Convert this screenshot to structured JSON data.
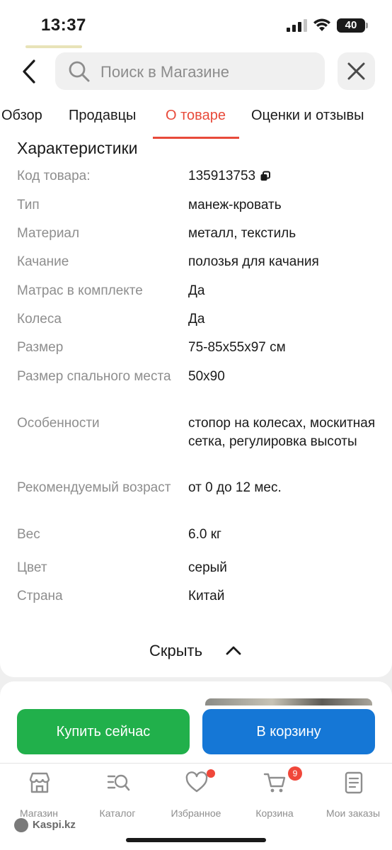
{
  "status_bar": {
    "time": "13:37",
    "battery": "40"
  },
  "search": {
    "placeholder": "Поиск в Магазине"
  },
  "tabs": [
    {
      "label": "Обзор",
      "active": false
    },
    {
      "label": "Продавцы",
      "active": false
    },
    {
      "label": "О товаре",
      "active": true
    },
    {
      "label": "Оценки и отзывы",
      "active": false
    }
  ],
  "specs": {
    "title": "Характеристики",
    "rows": [
      {
        "label": "Код товара:",
        "value": "135913753"
      },
      {
        "label": "Тип",
        "value": "манеж-кровать"
      },
      {
        "label": "Материал",
        "value": "металл, текстиль"
      },
      {
        "label": "Качание",
        "value": "полозья для качания"
      },
      {
        "label": "Матрас в комплекте",
        "value": "Да"
      },
      {
        "label": "Колеса",
        "value": "Да"
      },
      {
        "label": "Размер",
        "value": "75-85x55x97 см"
      },
      {
        "label": "Размер спального места",
        "value": "50x90"
      },
      {
        "label": "Особенности",
        "value": "стопор на колесах, москитная сетка, регулировка высоты"
      },
      {
        "label": "Рекомендуемый возраст",
        "value": "от 0 до 12 мес."
      },
      {
        "label": "Вес",
        "value": "6.0 кг"
      },
      {
        "label": "Цвет",
        "value": "серый"
      },
      {
        "label": "Страна",
        "value": "Китай"
      }
    ],
    "hide_label": "Скрыть"
  },
  "actions": {
    "buy_now": "Купить сейчас",
    "add_to_cart": "В корзину"
  },
  "bottom_nav": [
    {
      "label": "Магазин",
      "icon": "store-icon"
    },
    {
      "label": "Каталог",
      "icon": "catalog-search-icon"
    },
    {
      "label": "Избранное",
      "icon": "heart-icon"
    },
    {
      "label": "Корзина",
      "icon": "cart-icon",
      "badge": "9"
    },
    {
      "label": "Мои заказы",
      "icon": "orders-icon"
    }
  ],
  "watermark": "Kaspi.kz",
  "colors": {
    "accent_red": "#e84a3a",
    "buy_green": "#21b04b",
    "cart_blue": "#1577d6"
  }
}
